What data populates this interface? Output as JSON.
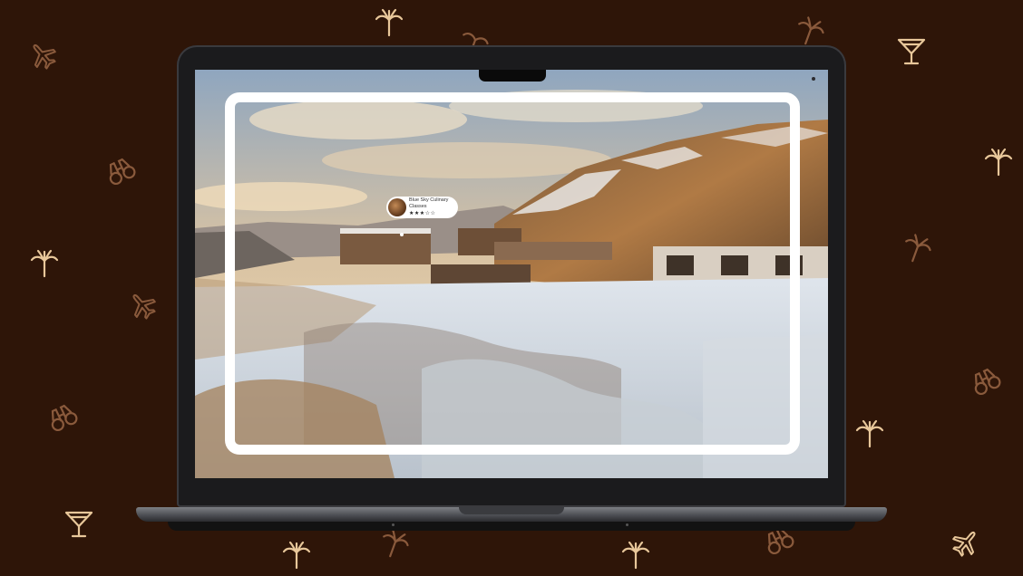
{
  "page": {
    "background_color": "#2e1508",
    "icon_color": "#e8c79a",
    "icon_color_dim": "#8a5a3c"
  },
  "background_icons": [
    "palm-tree-icon",
    "airplane-icon",
    "cocktail-glass-icon",
    "binoculars-icon"
  ],
  "laptop": {
    "screen": {
      "image": "snowy-mountain-resort-photo",
      "hotspot": {
        "title": "Blue Sky Culinary Classes",
        "rating": "★★★☆☆"
      }
    }
  }
}
